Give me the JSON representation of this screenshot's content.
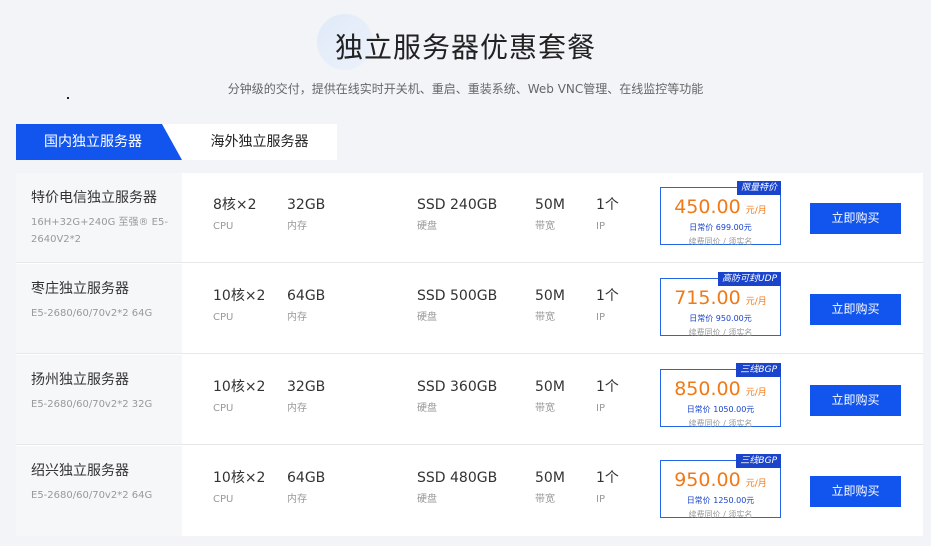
{
  "page": {
    "title": "独立服务器优惠套餐",
    "subtitle": "分钟级的交付，提供在线实时开关机、重启、重装系统、Web VNC管理、在线监控等功能"
  },
  "tabs": [
    {
      "label": "国内独立服务器",
      "active": true
    },
    {
      "label": "海外独立服务器",
      "active": false
    }
  ],
  "labels": {
    "cpu": "CPU",
    "memory": "内存",
    "disk": "硬盘",
    "bandwidth": "带宽",
    "ip": "IP",
    "unit": "元/月",
    "buy": "立即购买"
  },
  "servers": [
    {
      "name": "特价电信独立服务器",
      "desc": "16H+32G+240G 至强® E5-2640V2*2",
      "cpu": "8核×2",
      "memory": "32GB",
      "disk": "SSD 240GB",
      "bandwidth": "50M",
      "ip": "1个",
      "badge": "限量特价",
      "price": "450.00",
      "regular": "日常价 699.00元",
      "note": "续费同价 / 须实名"
    },
    {
      "name": "枣庄独立服务器",
      "desc": "E5-2680/60/70v2*2 64G",
      "cpu": "10核×2",
      "memory": "64GB",
      "disk": "SSD 500GB",
      "bandwidth": "50M",
      "ip": "1个",
      "badge": "高防可封UDP",
      "price": "715.00",
      "regular": "日常价 950.00元",
      "note": "续费同价 / 须实名"
    },
    {
      "name": "扬州独立服务器",
      "desc": "E5-2680/60/70v2*2 32G",
      "cpu": "10核×2",
      "memory": "32GB",
      "disk": "SSD 360GB",
      "bandwidth": "50M",
      "ip": "1个",
      "badge": "三线BGP",
      "price": "850.00",
      "regular": "日常价 1050.00元",
      "note": "续费同价 / 须实名"
    },
    {
      "name": "绍兴独立服务器",
      "desc": "E5-2680/60/70v2*2 64G",
      "cpu": "10核×2",
      "memory": "64GB",
      "disk": "SSD 480GB",
      "bandwidth": "50M",
      "ip": "1个",
      "badge": "三线BGP",
      "price": "950.00",
      "regular": "日常价 1250.00元",
      "note": "续费同价 / 须实名"
    }
  ],
  "colors": {
    "accent": "#1155ee",
    "price": "#f07a18",
    "badge": "#1a44cc"
  }
}
